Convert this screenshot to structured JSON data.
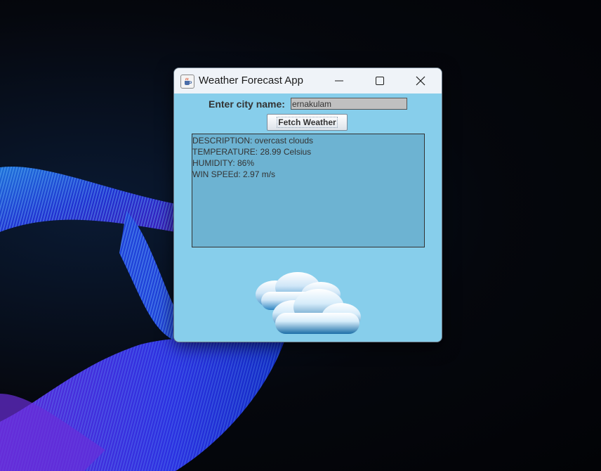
{
  "window": {
    "title": "Weather Forecast App"
  },
  "form": {
    "city_label": "Enter city name:",
    "city_value": "ernakulam",
    "fetch_label": "Fetch Weather"
  },
  "result": {
    "lines": [
      "DESCRIPTION: overcast clouds",
      "TEMPERATURE: 28.99 Celsius",
      "HUMIDITY: 86%",
      "WIN SPEEd: 2.97 m/s"
    ]
  },
  "icons": {
    "app": "java-coffee-cup-icon",
    "minimize": "minimize-icon",
    "maximize": "maximize-icon",
    "close": "close-icon",
    "weather": "overcast-clouds-icon"
  },
  "colors": {
    "window_bg": "#87ceeb",
    "result_bg": "#6db3d2",
    "input_bg": "#c0c0c0"
  }
}
